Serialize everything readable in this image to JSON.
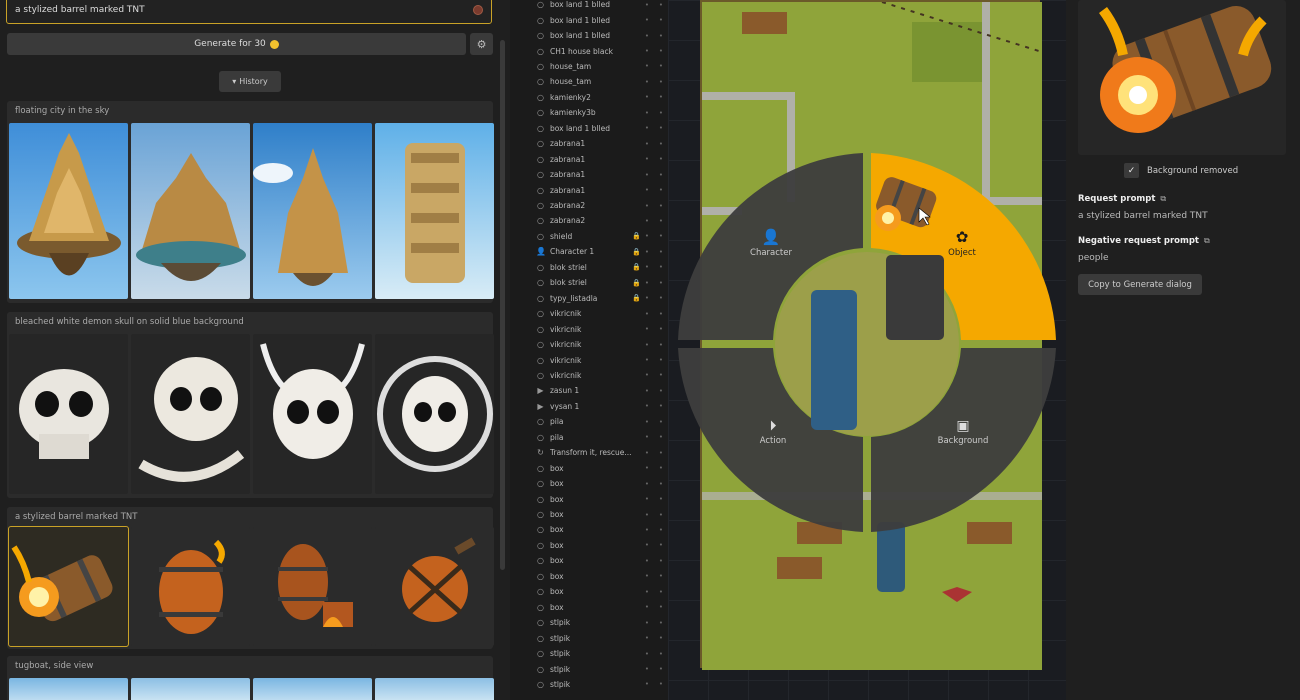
{
  "left": {
    "prompt_value": "a stylized barrel marked TNT",
    "generate_label": "Generate for 30",
    "history_label": "History",
    "groups": [
      {
        "title": "floating city in the sky"
      },
      {
        "title": "bleached white demon skull on solid blue background"
      },
      {
        "title": "a stylized barrel marked TNT"
      },
      {
        "title": "tugboat, side view"
      }
    ]
  },
  "layers": [
    {
      "icon": "circle",
      "name": "box land 1 blled",
      "lock": false
    },
    {
      "icon": "circle",
      "name": "box land 1 blled",
      "lock": false
    },
    {
      "icon": "circle",
      "name": "box land 1 blled",
      "lock": false
    },
    {
      "icon": "circle",
      "name": "CH1 house black",
      "lock": false
    },
    {
      "icon": "circle",
      "name": "house_tam",
      "lock": false
    },
    {
      "icon": "circle",
      "name": "house_tam",
      "lock": false
    },
    {
      "icon": "circle",
      "name": "kamienky2",
      "lock": false
    },
    {
      "icon": "circle",
      "name": "kamienky3b",
      "lock": false
    },
    {
      "icon": "circle",
      "name": "box land 1 blled",
      "lock": false
    },
    {
      "icon": "circle",
      "name": "zabrana1",
      "lock": false
    },
    {
      "icon": "circle",
      "name": "zabrana1",
      "lock": false
    },
    {
      "icon": "circle",
      "name": "zabrana1",
      "lock": false
    },
    {
      "icon": "circle",
      "name": "zabrana1",
      "lock": false
    },
    {
      "icon": "circle",
      "name": "zabrana2",
      "lock": false
    },
    {
      "icon": "circle",
      "name": "zabrana2",
      "lock": false
    },
    {
      "icon": "circle",
      "name": "shield",
      "lock": true
    },
    {
      "icon": "person",
      "name": "Character 1",
      "lock": true
    },
    {
      "icon": "circle",
      "name": "blok striel",
      "lock": true
    },
    {
      "icon": "circle",
      "name": "blok striel",
      "lock": true
    },
    {
      "icon": "circle",
      "name": "typy_listadla",
      "lock": true
    },
    {
      "icon": "circle",
      "name": "vikricnik",
      "lock": false
    },
    {
      "icon": "circle",
      "name": "vikricnik",
      "lock": false
    },
    {
      "icon": "circle",
      "name": "vikricnik",
      "lock": false
    },
    {
      "icon": "circle",
      "name": "vikricnik",
      "lock": false
    },
    {
      "icon": "circle",
      "name": "vikricnik",
      "lock": false
    },
    {
      "icon": "play",
      "name": "zasun 1",
      "lock": false
    },
    {
      "icon": "play",
      "name": "vysan 1",
      "lock": false
    },
    {
      "icon": "circle",
      "name": "pila",
      "lock": false
    },
    {
      "icon": "circle",
      "name": "pila",
      "lock": false
    },
    {
      "icon": "refresh",
      "name": "Transform it, rescue...",
      "lock": false
    },
    {
      "icon": "circle",
      "name": "box",
      "lock": false
    },
    {
      "icon": "circle",
      "name": "box",
      "lock": false
    },
    {
      "icon": "circle",
      "name": "box",
      "lock": false
    },
    {
      "icon": "circle",
      "name": "box",
      "lock": false
    },
    {
      "icon": "circle",
      "name": "box",
      "lock": false
    },
    {
      "icon": "circle",
      "name": "box",
      "lock": false
    },
    {
      "icon": "circle",
      "name": "box",
      "lock": false
    },
    {
      "icon": "circle",
      "name": "box",
      "lock": false
    },
    {
      "icon": "circle",
      "name": "box",
      "lock": false
    },
    {
      "icon": "circle",
      "name": "box",
      "lock": false
    },
    {
      "icon": "circle",
      "name": "stlpik",
      "lock": false
    },
    {
      "icon": "circle",
      "name": "stlpik",
      "lock": false
    },
    {
      "icon": "circle",
      "name": "stlpik",
      "lock": false
    },
    {
      "icon": "circle",
      "name": "stlpik",
      "lock": false
    },
    {
      "icon": "circle",
      "name": "stlpik",
      "lock": false
    }
  ],
  "radial_menu": {
    "character": "Character",
    "object": "Object",
    "action": "Action",
    "background": "Background"
  },
  "right": {
    "bg_removed_label": "Background removed",
    "request_prompt_label": "Request prompt",
    "request_prompt_value": "a stylized barrel marked TNT",
    "negative_prompt_label": "Negative request prompt",
    "negative_prompt_value": "people",
    "copy_label": "Copy to Generate dialog"
  },
  "colors": {
    "accent": "#f5a800",
    "selection_border": "#c9a227",
    "field_grass": "#8fa43a"
  }
}
